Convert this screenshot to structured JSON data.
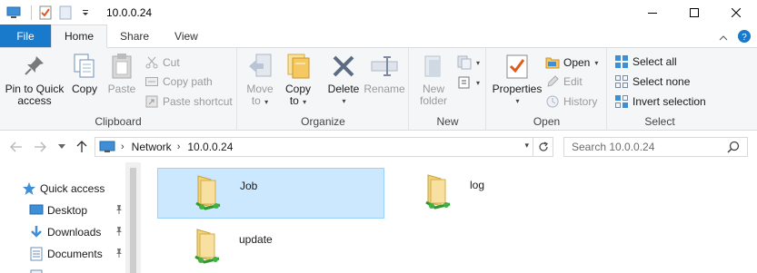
{
  "window": {
    "title": "10.0.0.24"
  },
  "tabs": [
    {
      "label": "File"
    },
    {
      "label": "Home"
    },
    {
      "label": "Share"
    },
    {
      "label": "View"
    }
  ],
  "ribbon": {
    "clipboard": {
      "label": "Clipboard",
      "pin": "Pin to Quick\naccess",
      "pin_line1": "Pin to Quick",
      "pin_line2": "access",
      "copy": "Copy",
      "paste": "Paste",
      "cut": "Cut",
      "copy_path": "Copy path",
      "paste_shortcut": "Paste shortcut"
    },
    "organize": {
      "label": "Organize",
      "move_to_line1": "Move",
      "move_to_line2": "to",
      "copy_to_line1": "Copy",
      "copy_to_line2": "to",
      "delete": "Delete",
      "rename": "Rename"
    },
    "new": {
      "label": "New",
      "new_folder_line1": "New",
      "new_folder_line2": "folder"
    },
    "open": {
      "label": "Open",
      "properties": "Properties",
      "open": "Open",
      "edit": "Edit",
      "history": "History"
    },
    "select": {
      "label": "Select",
      "select_all": "Select all",
      "select_none": "Select none",
      "invert_selection": "Invert selection"
    }
  },
  "address": {
    "crumbs": [
      "Network",
      "10.0.0.24"
    ],
    "search_placeholder": "Search 10.0.0.24"
  },
  "navpane": {
    "items": [
      {
        "label": "Quick access",
        "icon": "star-icon"
      },
      {
        "label": "Desktop",
        "icon": "desktop-icon",
        "pinned": true
      },
      {
        "label": "Downloads",
        "icon": "download-icon",
        "pinned": true
      },
      {
        "label": "Documents",
        "icon": "documents-icon",
        "pinned": true
      }
    ]
  },
  "content": {
    "items": [
      {
        "name": "Job",
        "selected": true
      },
      {
        "name": "log",
        "selected": false
      },
      {
        "name": "update",
        "selected": false
      }
    ]
  },
  "colors": {
    "accent": "#1979ca",
    "selection": "#cce8ff",
    "selection_border": "#99d1ff",
    "ribbon_bg": "#f5f6f7"
  }
}
